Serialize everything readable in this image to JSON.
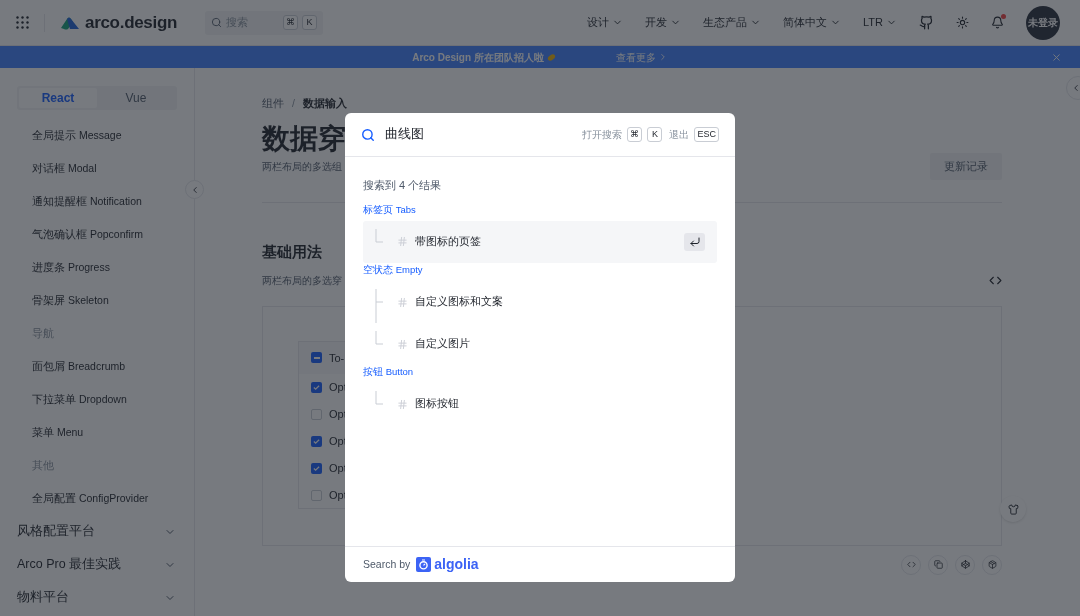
{
  "header": {
    "logo": "arco.design",
    "search": {
      "placeholder": "搜索",
      "keys": [
        "⌘",
        "K"
      ]
    },
    "nav": [
      {
        "label": "设计"
      },
      {
        "label": "开发"
      },
      {
        "label": "生态产品"
      },
      {
        "label": "简体中文"
      },
      {
        "label": "LTR"
      }
    ],
    "has_unread": true,
    "avatar": "未登录"
  },
  "banner": {
    "text": "Arco Design 所在团队招人啦",
    "link": "查看更多"
  },
  "sidebar": {
    "tabs": [
      {
        "label": "React",
        "selected": true
      },
      {
        "label": "Vue",
        "selected": false
      }
    ],
    "items": [
      {
        "kind": "item",
        "label": "全局提示 Message"
      },
      {
        "kind": "item",
        "label": "对话框 Modal"
      },
      {
        "kind": "item",
        "label": "通知提醒框 Notification"
      },
      {
        "kind": "item",
        "label": "气泡确认框 Popconfirm"
      },
      {
        "kind": "item",
        "label": "进度条 Progress"
      },
      {
        "kind": "item",
        "label": "骨架屏 Skeleton"
      },
      {
        "kind": "group",
        "label": "导航"
      },
      {
        "kind": "item",
        "label": "面包屑 Breadcrumb"
      },
      {
        "kind": "item",
        "label": "下拉菜单 Dropdown"
      },
      {
        "kind": "item",
        "label": "菜单 Menu"
      },
      {
        "kind": "group",
        "label": "其他"
      },
      {
        "kind": "item",
        "label": "全局配置 ConfigProvider"
      },
      {
        "kind": "section",
        "label": "风格配置平台"
      },
      {
        "kind": "section",
        "label": "Arco Pro 最佳实践"
      },
      {
        "kind": "section",
        "label": "物料平台"
      }
    ]
  },
  "content": {
    "breadcrumb": {
      "items": [
        "组件",
        "数据输入"
      ],
      "separator": "/"
    },
    "title": "数据穿",
    "subtitle": "两栏布局的多选组",
    "changelog_button": "更新记录",
    "section_title": "基础用法",
    "section_desc": "两栏布局的多选穿",
    "transfer": {
      "header": {
        "label": "To-",
        "indeterminate": true
      },
      "options": [
        {
          "label": "Opt",
          "checked": true
        },
        {
          "label": "Opt",
          "checked": false
        },
        {
          "label": "Opt",
          "checked": true
        },
        {
          "label": "Opt",
          "checked": true
        },
        {
          "label": "Opt",
          "checked": false
        }
      ]
    }
  },
  "search_modal": {
    "query": "曲线图",
    "hints": [
      {
        "label": "打开搜索",
        "keys": [
          "⌘",
          "K"
        ]
      },
      {
        "label": "退出",
        "keys": [
          "ESC"
        ]
      }
    ],
    "count": "搜索到 4 个结果",
    "groups": [
      {
        "title": "标签页 Tabs",
        "items": [
          {
            "label": "带图标的页签",
            "selected": true
          }
        ]
      },
      {
        "title": "空状态 Empty",
        "items": [
          {
            "label": "自定义图标和文案",
            "selected": false
          },
          {
            "label": "自定义图片",
            "selected": false
          }
        ]
      },
      {
        "title": "按钮 Button",
        "items": [
          {
            "label": "图标按钮",
            "selected": false
          }
        ]
      }
    ],
    "footer": {
      "label": "Search by",
      "brand": "algolia"
    }
  }
}
